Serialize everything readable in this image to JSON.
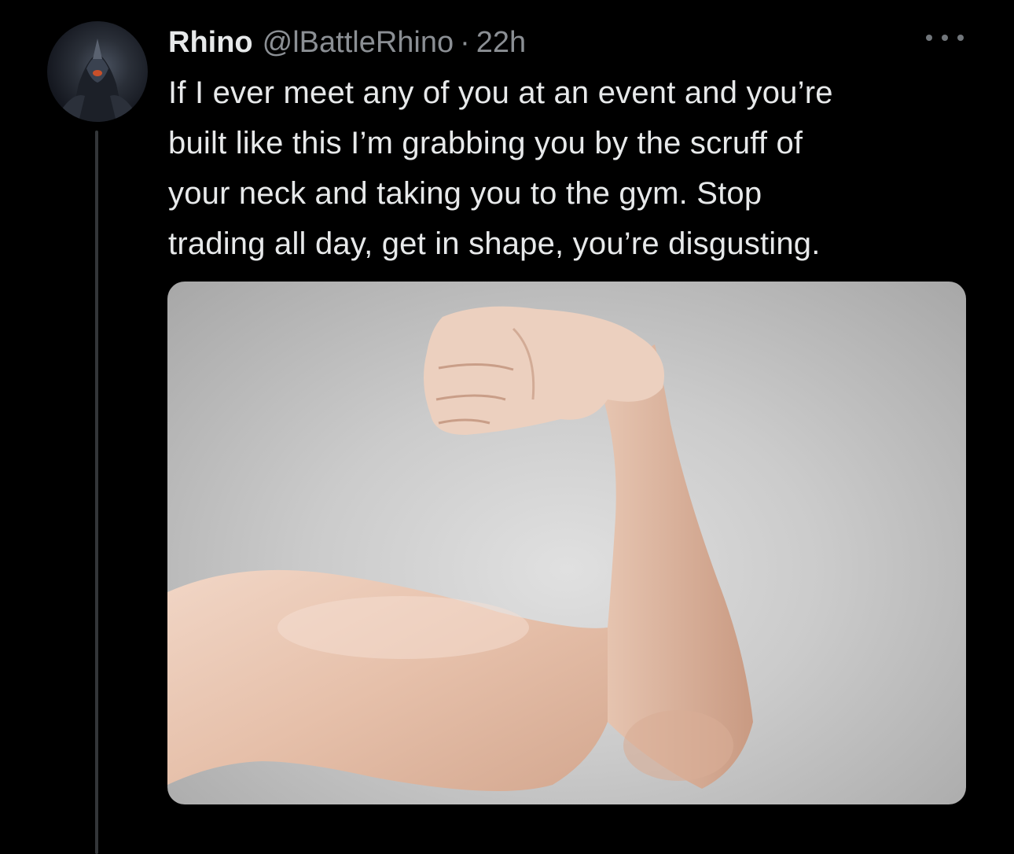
{
  "tweet": {
    "display_name": "Rhino",
    "handle": "@lBattleRhino",
    "separator": "·",
    "timestamp": "22h",
    "text_lines": [
      "If I ever meet any of you at an event and you’re",
      "built like this I’m grabbing you by the scruff of",
      "your neck and taking you to the gym. Stop",
      "trading all day, get in shape, you’re disgusting."
    ],
    "more_icon": "more-horizontal-icon",
    "media_subject": "flexed-arm"
  },
  "colors": {
    "background": "#000000",
    "text_primary": "#e7e9ea",
    "text_secondary": "#8b8f94",
    "thread_line": "#333639"
  }
}
